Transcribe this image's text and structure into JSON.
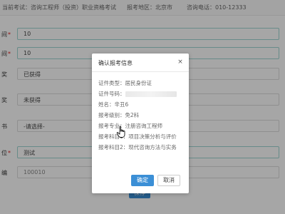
{
  "header": {
    "exam_label": "当前考试：咨询工程师（投资）职业资格考试",
    "region_label": "报考地区：北京市",
    "phone_label": "咨询电话：010-12333"
  },
  "form": {
    "rows": [
      {
        "label_fragment": "间",
        "value": "10",
        "required": "*"
      },
      {
        "label_fragment": "间",
        "value": "10",
        "required": "*"
      },
      {
        "label_fragment": "奖",
        "value": "已获得"
      },
      {
        "label_fragment": "奖",
        "value": "未获得"
      },
      {
        "label_fragment": "书",
        "value": "-请选择-"
      },
      {
        "label_fragment": "位",
        "value": "测试",
        "required": "*"
      },
      {
        "label_fragment": "编",
        "value": "100010"
      }
    ],
    "save_label": "保存"
  },
  "modal": {
    "title": "确认报考信息",
    "close_symbol": "×",
    "id_type": "证件类型：居民身份证",
    "id_number_label": "证件号码：",
    "name": "姓名：辛丑6",
    "level": "报考级别：免2科",
    "major": "报考专业：注册咨询工程师",
    "subject1": "报考科目1：项目决策分析与评价",
    "subject2": "报考科目2：现代咨询方法与实务",
    "confirm_label": "确定",
    "cancel_label": "取消"
  },
  "colors": {
    "primary": "#3b8fd6",
    "field_border_active": "#9fd6d3",
    "required": "#e02020"
  }
}
